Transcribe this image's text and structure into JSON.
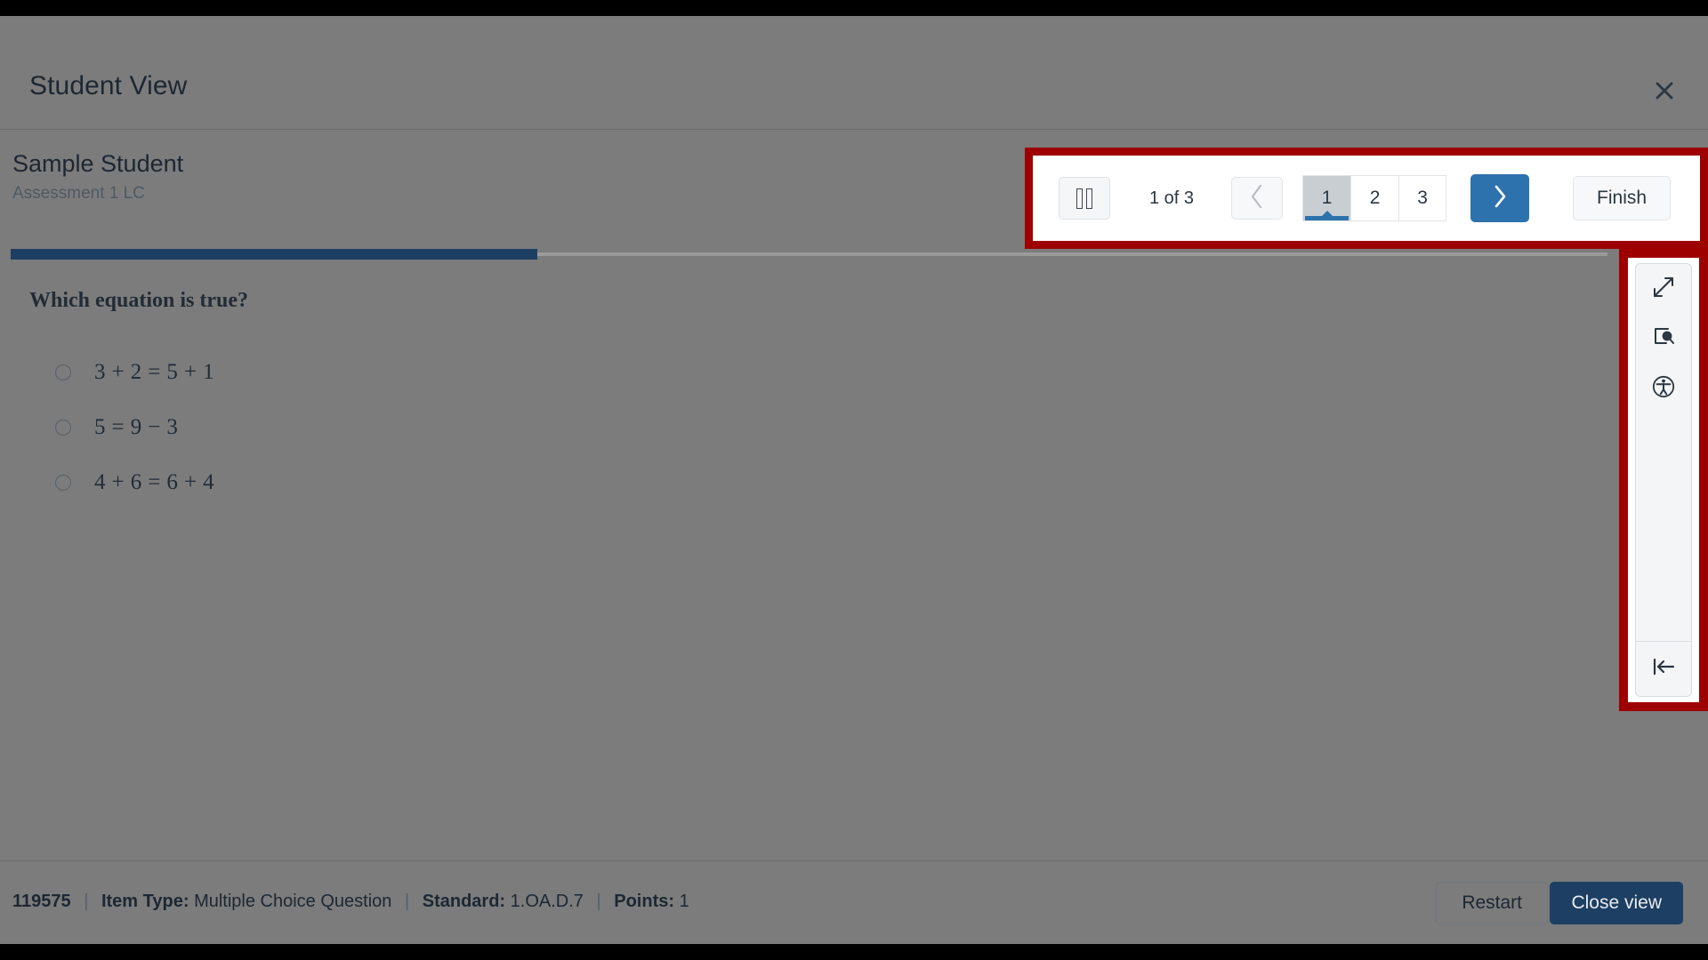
{
  "modal": {
    "title": "Student View",
    "close_icon": "close-icon"
  },
  "student": {
    "name": "Sample Student",
    "assessment": "Assessment 1 LC"
  },
  "nav": {
    "pause_icon": "pause-icon",
    "counter": "1 of 3",
    "prev_icon": "chevron-left-icon",
    "next_icon": "chevron-right-icon",
    "pages": [
      {
        "label": "1",
        "active": true
      },
      {
        "label": "2",
        "active": false
      },
      {
        "label": "3",
        "active": false
      }
    ],
    "finish_label": "Finish",
    "highlight_color": "#9e0000",
    "accent_color": "#2e72ad"
  },
  "progress": {
    "percent": 33
  },
  "question": {
    "stem": "Which equation is true?",
    "choices": [
      {
        "text": "3 + 2 = 5 + 1",
        "selected": false
      },
      {
        "text": "5 = 9 − 3",
        "selected": false
      },
      {
        "text": "4 + 6 = 6 + 4",
        "selected": false
      }
    ]
  },
  "tool_rail": {
    "buttons": [
      {
        "icon": "expand-fullscreen-icon"
      },
      {
        "icon": "zoom-region-icon"
      },
      {
        "icon": "accessibility-icon"
      }
    ],
    "collapse": {
      "icon": "collapse-left-icon"
    }
  },
  "footer": {
    "item_id": "119575",
    "separator": "|",
    "item_type_label": "Item Type:",
    "item_type_value": "Multiple Choice Question",
    "standard_label": "Standard:",
    "standard_value": "1.OA.D.7",
    "points_label": "Points:",
    "points_value": "1",
    "restart_label": "Restart",
    "close_view_label": "Close view",
    "close_view_color": "#1d3f63"
  }
}
